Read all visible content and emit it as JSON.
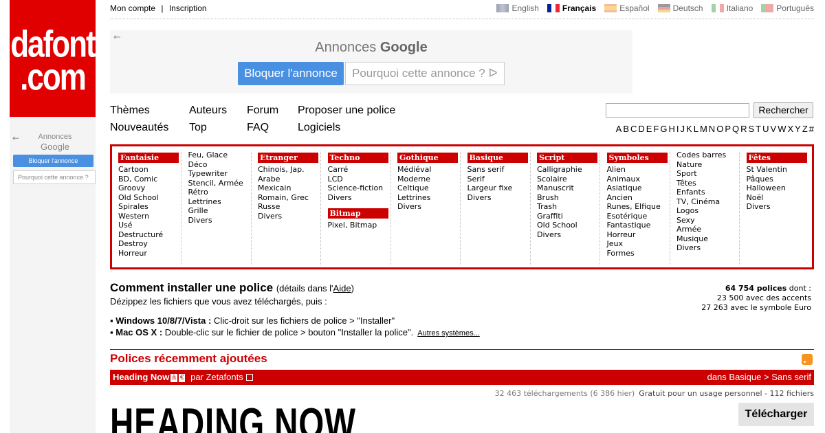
{
  "logo": {
    "line1": "dafont",
    "line2": ".com"
  },
  "left_ad": {
    "label1": "Annonces",
    "label2": "Google",
    "block": "Bloquer l'annonce",
    "why": "Pourquoi cette annonce ?"
  },
  "account": {
    "my_account": "Mon compte",
    "sep": "|",
    "signup": "Inscription"
  },
  "languages": [
    {
      "label": "English",
      "flag": "en",
      "active": false
    },
    {
      "label": "Français",
      "flag": "fr",
      "active": true
    },
    {
      "label": "Español",
      "flag": "es",
      "active": false
    },
    {
      "label": "Deutsch",
      "flag": "de",
      "active": false
    },
    {
      "label": "Italiano",
      "flag": "it",
      "active": false
    },
    {
      "label": "Português",
      "flag": "pt",
      "active": false
    }
  ],
  "top_ad": {
    "title_prefix": "Annonces ",
    "title_brand": "Google",
    "block": "Bloquer l'annonce",
    "why": "Pourquoi cette annonce ? ᐅ"
  },
  "nav": {
    "themes": "Thèmes",
    "authors": "Auteurs",
    "forum": "Forum",
    "submit": "Proposer une police",
    "new": "Nouveautés",
    "top": "Top",
    "faq": "FAQ",
    "software": "Logiciels"
  },
  "search": {
    "button": "Rechercher",
    "value": ""
  },
  "alphabet": [
    "A",
    "B",
    "C",
    "D",
    "E",
    "F",
    "G",
    "H",
    "I",
    "J",
    "K",
    "L",
    "M",
    "N",
    "O",
    "P",
    "Q",
    "R",
    "S",
    "T",
    "U",
    "V",
    "W",
    "X",
    "Y",
    "Z",
    "#"
  ],
  "categories": [
    {
      "sections": [
        {
          "head": "Fantaisie",
          "items": [
            "Cartoon",
            "BD, Comic",
            "Groovy",
            "Old School",
            "Spirales",
            "Western",
            "Usé",
            "Destructuré",
            "Destroy",
            "Horreur"
          ]
        }
      ]
    },
    {
      "sections": [
        {
          "head": "",
          "items": [
            "Feu, Glace",
            "Déco",
            "Typewriter",
            "Stencil, Armée",
            "Rétro",
            "Lettrines",
            "Grille",
            "Divers"
          ]
        }
      ]
    },
    {
      "sections": [
        {
          "head": "Etranger",
          "items": [
            "Chinois, Jap.",
            "Arabe",
            "Mexicain",
            "Romain, Grec",
            "Russe",
            "Divers"
          ]
        }
      ]
    },
    {
      "sections": [
        {
          "head": "Techno",
          "items": [
            "Carré",
            "LCD",
            "Science-fiction",
            "Divers"
          ]
        },
        {
          "head": "Bitmap",
          "items": [
            "Pixel, Bitmap"
          ]
        }
      ]
    },
    {
      "sections": [
        {
          "head": "Gothique",
          "items": [
            "Médiéval",
            "Moderne",
            "Celtique",
            "Lettrines",
            "Divers"
          ]
        }
      ]
    },
    {
      "sections": [
        {
          "head": "Basique",
          "items": [
            "Sans serif",
            "Serif",
            "Largeur fixe",
            "Divers"
          ]
        }
      ]
    },
    {
      "sections": [
        {
          "head": "Script",
          "items": [
            "Calligraphie",
            "Scolaire",
            "Manuscrit",
            "Brush",
            "Trash",
            "Graffiti",
            "Old School",
            "Divers"
          ]
        }
      ]
    },
    {
      "sections": [
        {
          "head": "Symboles",
          "items": [
            "Alien",
            "Animaux",
            "Asiatique",
            "Ancien",
            "Runes, Elfique",
            "Esotérique",
            "Fantastique",
            "Horreur",
            "Jeux",
            "Formes"
          ]
        }
      ]
    },
    {
      "sections": [
        {
          "head": "",
          "items": [
            "Codes barres",
            "Nature",
            "Sport",
            "Têtes",
            "Enfants",
            "TV, Cinéma",
            "Logos",
            "Sexy",
            "Armée",
            "Musique",
            "Divers"
          ]
        }
      ]
    },
    {
      "sections": [
        {
          "head": "Fêtes",
          "items": [
            "St Valentin",
            "Pâques",
            "Halloween",
            "Noël",
            "Divers"
          ]
        }
      ]
    }
  ],
  "install": {
    "title": "Comment installer une police",
    "sub_prefix": "(détails dans l'",
    "sub_link": "Aide",
    "sub_suffix": ")",
    "desc": "Dézippez les fichiers que vous avez téléchargés, puis :",
    "win_label": "Windows 10/8/7/Vista :",
    "win_text": " Clic-droit sur les fichiers de police > \"Installer\"",
    "mac_label": "Mac OS X :",
    "mac_text": " Double-clic sur le fichier de police > bouton \"Installer la police\".",
    "more": "Autres systèmes..."
  },
  "stats": {
    "count": "64 754 polices",
    "suffix": " dont :",
    "accents": "23 500 avec des accents",
    "euro": "27 263 avec le symbole Euro"
  },
  "recent": {
    "title": "Polices récemment ajoutées",
    "font_name": "Heading Now",
    "chip1": "à",
    "chip2": "€",
    "author": "par Zetafonts",
    "category": "dans Basique > Sans serif",
    "downloads": "32 463 téléchargements (6 386 hier)",
    "license": "Gratuit pour un usage personnel - 112 fichiers",
    "preview_text": "HEADING NOW",
    "download": "Télécharger"
  },
  "colors": {
    "accent": "#cc0000",
    "logo": "#e10000",
    "ad_button": "#4a90e2"
  }
}
